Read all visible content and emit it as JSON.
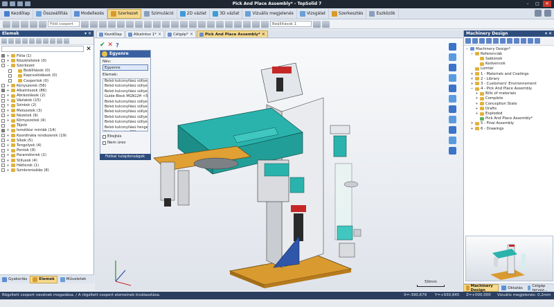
{
  "window": {
    "title": "Pick And Place Assembly* - TopSolid 7"
  },
  "ribbon_tabs": [
    {
      "label": "Kezdőlap",
      "color": "#4a7fd0"
    },
    {
      "label": "Összeállítás",
      "color": "#6aa0d8"
    },
    {
      "label": "Modellezés",
      "color": "#5a8ed6"
    },
    {
      "label": "Szerkezet",
      "color": "#d89a2b"
    },
    {
      "label": "Szimuláció",
      "color": "#8a9fbf"
    },
    {
      "label": "2D vázlat",
      "color": "#3f9bd8"
    },
    {
      "label": "3D vázlat",
      "color": "#3f9bd8"
    },
    {
      "label": "Vizuális megjelenés",
      "color": "#6aa0d8"
    },
    {
      "label": "Vizsgálat",
      "color": "#6aa0d8"
    },
    {
      "label": "Szerkesztés",
      "color": "#d89a2b"
    },
    {
      "label": "Eszközök",
      "color": "#8a9fbf"
    }
  ],
  "toolbar": {
    "sel1": "Föld csoport",
    "sel2": "Beállítások 1"
  },
  "left_panel": {
    "title": "Elemek",
    "items": [
      {
        "label": "Fólia (1)",
        "ex": "+",
        "cb": true
      },
      {
        "label": "Közzétételek (0)",
        "ex": "+",
        "cb": false
      },
      {
        "label": "Szerkezet",
        "ex": "−",
        "cb": false
      },
      {
        "label": "Beállítások (0)",
        "ex": "",
        "cb": false
      },
      {
        "label": "Kapcsolódások (0)",
        "ex": "",
        "cb": false
      },
      {
        "label": "Csoportok (0)",
        "ex": "",
        "cb": false
      },
      {
        "label": "Kényszerek (56)",
        "ex": "+",
        "cb": false
      },
      {
        "label": "Alkatrészek (86)",
        "ex": "+",
        "cb": true
      },
      {
        "label": "Ábrázolások (2)",
        "ex": "+",
        "cb": false
      },
      {
        "label": "Vázlatok (15)",
        "ex": "+",
        "cb": false
      },
      {
        "label": "Szintek (2)",
        "ex": "+",
        "cb": false
      },
      {
        "label": "Metszetek (3)",
        "ex": "+",
        "cb": false
      },
      {
        "label": "Nézetek (9)",
        "ex": "+",
        "cb": false
      },
      {
        "label": "Környezetek (4)",
        "ex": "+",
        "cb": false
      },
      {
        "label": "Tájoló",
        "ex": "",
        "cb": false
      },
      {
        "label": "Ismétlési minták (14)",
        "ex": "+",
        "cb": true
      },
      {
        "label": "Koordináta rendszerek (19)",
        "ex": "+",
        "cb": false
      },
      {
        "label": "Síkok (5)",
        "ex": "+",
        "cb": false
      },
      {
        "label": "Tengelyek (4)",
        "ex": "+",
        "cb": false
      },
      {
        "label": "Pontok (9)",
        "ex": "+",
        "cb": false
      },
      {
        "label": "Paraméterek (1)",
        "ex": "+",
        "cb": false
      },
      {
        "label": "Stílusok (4)",
        "ex": "+",
        "cb": false
      },
      {
        "label": "Hátterek (1)",
        "ex": "+",
        "cb": false
      },
      {
        "label": "Szinkronizálás (8)",
        "ex": "+",
        "cb": false
      }
    ],
    "bottom_tabs": [
      "Gyakorlás",
      "Elemek",
      "Műveletek"
    ]
  },
  "doc_tabs": [
    "Kezdőlap",
    "Alkatrész 1*",
    "Célgép*",
    "Pick And Place Assembly*"
  ],
  "float_panel": {
    "title": "Egyenre",
    "name_label": "Név:",
    "name_value": "Egyenre",
    "list_label": "Elemek:",
    "list_items": [
      "Belső kulcsnyílású süllyes...",
      "Belső kulcsnyílású süllyes...",
      "Belső kulcsnyílású süllyes...",
      "Guide Block MGN12H <5",
      "Belső kulcsnyílású süllyes...",
      "Belső kulcsnyílású süllyes...",
      "Belső kulcsnyílású süllyes...",
      "Belső kulcsnyílású süllyes...",
      "Belső kulcsnyílású süllyes...",
      "Belső kulcsnyílású henger",
      "Föld csoport <731>"
    ],
    "check1": "Elrejtés",
    "check2": "Nem üres",
    "footer": "Fizikai tulajdonságok"
  },
  "viewport": {
    "scale_label": "50mm"
  },
  "right_panel": {
    "title": "Machinery Design",
    "items": [
      {
        "label": "Machinery Design*",
        "ex": "−",
        "ic": "blue",
        "indent": 0
      },
      {
        "label": "Referenciák",
        "ex": "−",
        "ic": "yellow",
        "indent": 1
      },
      {
        "label": "Sablonok",
        "ex": "",
        "ic": "yellow",
        "indent": 2
      },
      {
        "label": "Kedvencek",
        "ex": "",
        "ic": "yellow",
        "indent": 2
      },
      {
        "label": "Lomtár",
        "ex": "",
        "ic": "yellow",
        "indent": 1
      },
      {
        "label": "1 - Materials and Coatings",
        "ex": "+",
        "ic": "yellow",
        "indent": 1
      },
      {
        "label": "2 - Library",
        "ex": "+",
        "ic": "yellow",
        "indent": 1
      },
      {
        "label": "3 - Customers' Environnement",
        "ex": "+",
        "ic": "yellow",
        "indent": 1
      },
      {
        "label": "4 - Pick And Place Assembly",
        "ex": "−",
        "ic": "yellow",
        "indent": 1
      },
      {
        "label": "Bills of materials",
        "ex": "+",
        "ic": "yellow",
        "indent": 2
      },
      {
        "label": "Complete",
        "ex": "+",
        "ic": "yellow",
        "indent": 2
      },
      {
        "label": "Conception State",
        "ex": "+",
        "ic": "yellow",
        "indent": 2
      },
      {
        "label": "Drafts",
        "ex": "+",
        "ic": "yellow",
        "indent": 2
      },
      {
        "label": "Exploded",
        "ex": "+",
        "ic": "yellow",
        "indent": 2
      },
      {
        "label": "Pick And Place Assembly*",
        "ex": "",
        "ic": "green",
        "indent": 2
      },
      {
        "label": "5 - Final Assembly",
        "ex": "+",
        "ic": "yellow",
        "indent": 1
      },
      {
        "label": "6 - Drawings",
        "ex": "+",
        "ic": "yellow",
        "indent": 1
      }
    ],
    "bottom_tabs": [
      "Machinery Design",
      "Oktatás",
      "Célgép tervez..."
    ]
  },
  "status": {
    "message": "Rögzített csoport nevének megadása. / A rögzített csoport elemeinek kiválasztása.",
    "x": "X=-390,679",
    "y": "Y=+930,845",
    "z": "Z=+000,000",
    "visual": "Vizuális megjelenés: 0,2mm 15°"
  }
}
